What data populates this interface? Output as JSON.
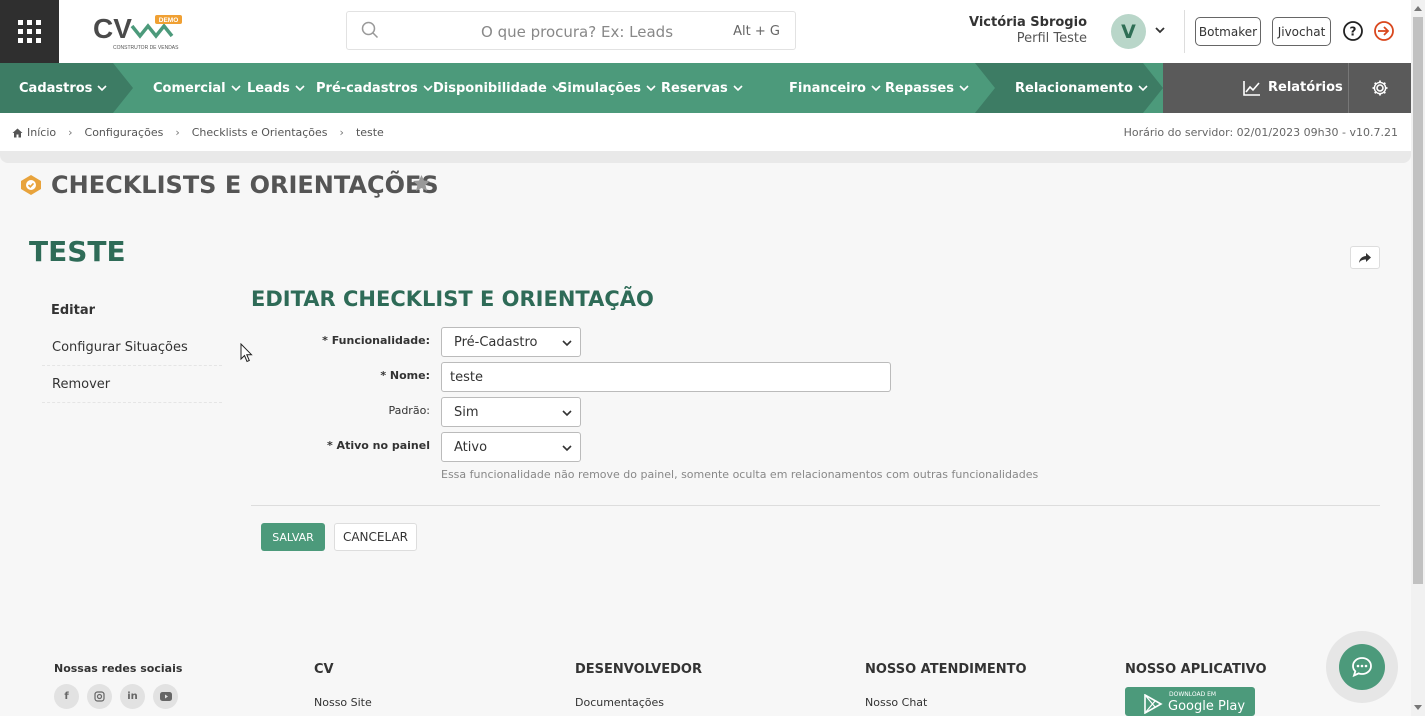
{
  "header": {
    "logo_text": "CV",
    "logo_badge": "DEMO",
    "logo_sub": "CONSTRUTOR DE VENDAS",
    "search_placeholder": "O que procura? Ex: Leads",
    "search_shortcut": "Alt + G",
    "user_name": "Victória Sbrogio",
    "user_profile": "Perfil Teste",
    "avatar_letter": "V",
    "botmaker_label": "Botmaker",
    "jivochat_label": "Jivochat"
  },
  "nav": {
    "items": [
      "Cadastros",
      "Comercial",
      "Leads",
      "Pré-cadastros",
      "Disponibilidade",
      "Simulações",
      "Reservas",
      "Financeiro",
      "Repasses",
      "Relacionamento"
    ],
    "reports_label": "Relatórios"
  },
  "breadcrumb": {
    "items": [
      "Início",
      "Configurações",
      "Checklists e Orientações",
      "teste"
    ],
    "server_info": "Horário do servidor: 02/01/2023 09h30 - v10.7.21"
  },
  "page": {
    "title": "CHECKLISTS E ORIENTAÇÕES",
    "record_title": "TESTE"
  },
  "sidebar": {
    "items": [
      "Editar",
      "Configurar Situações",
      "Remover"
    ]
  },
  "form": {
    "title": "EDITAR CHECKLIST E ORIENTAÇÃO",
    "funcionalidade_label": "* Funcionalidade:",
    "funcionalidade_value": "Pré-Cadastro",
    "nome_label": "* Nome:",
    "nome_value": "teste",
    "padrao_label": "Padrão:",
    "padrao_value": "Sim",
    "ativo_label": "* Ativo no painel",
    "ativo_value": "Ativo",
    "hint": "Essa funcionalidade não remove do painel, somente oculta em relacionamentos com outras funcionalidades",
    "save_label": "SALVAR",
    "cancel_label": "CANCELAR"
  },
  "footer": {
    "social_title": "Nossas redes sociais",
    "cv_title": "CV",
    "cv_link": "Nosso Site",
    "dev_title": "DESENVOLVEDOR",
    "dev_link": "Documentações",
    "support_title": "NOSSO ATENDIMENTO",
    "support_link": "Nosso Chat",
    "app_title": "NOSSO APLICATIVO",
    "gplay_small": "DOWNLOAD EM",
    "gplay_big": "Google Play"
  },
  "colors": {
    "brand_green": "#4c9a7b",
    "dark_green": "#2e6b57",
    "nav_dark": "#3d7c64",
    "logout_red": "#d9471d"
  }
}
